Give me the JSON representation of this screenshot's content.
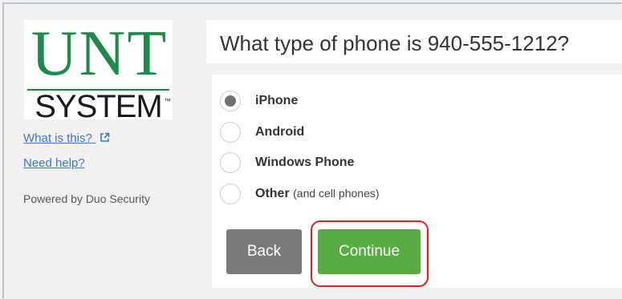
{
  "logo": {
    "top_text": "UNT",
    "bottom_text": "SYSTEM",
    "tm": "™"
  },
  "sidebar": {
    "what_is_this": "What is this?",
    "need_help": "Need help?",
    "powered_by": "Powered by Duo Security"
  },
  "question": "What type of phone is 940-555-1212?",
  "options": [
    {
      "label": "iPhone",
      "note": "",
      "checked": true
    },
    {
      "label": "Android",
      "note": "",
      "checked": false
    },
    {
      "label": "Windows Phone",
      "note": "",
      "checked": false
    },
    {
      "label": "Other",
      "note": "(and cell phones)",
      "checked": false
    }
  ],
  "buttons": {
    "back": "Back",
    "continue": "Continue"
  },
  "colors": {
    "brand_green": "#1e8a4a",
    "continue_green": "#58ac42",
    "back_gray": "#7a7a7a",
    "link_blue": "#3a77bd",
    "highlight_red": "#e02020"
  },
  "icons": {
    "external_link": "external-link-icon"
  }
}
